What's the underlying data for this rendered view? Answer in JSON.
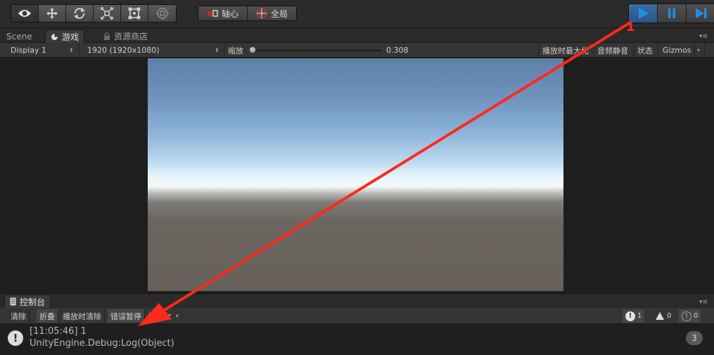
{
  "toolbar": {
    "tools": [
      {
        "name": "hand-tool",
        "icon": "eye-icon"
      },
      {
        "name": "move-tool",
        "icon": "move-icon"
      },
      {
        "name": "rotate-tool",
        "icon": "rotate-icon"
      },
      {
        "name": "scale-tool",
        "icon": "scale-icon"
      },
      {
        "name": "rect-tool",
        "icon": "rect-icon"
      },
      {
        "name": "transform-tool",
        "icon": "transform-icon"
      }
    ],
    "pivot_label": "轴心",
    "global_label": "全局",
    "play": {
      "active": true,
      "accent": "#3a6fa5",
      "icon_color": "#1e8fe8"
    }
  },
  "tabs": {
    "scene": "Scene",
    "game": "游戏",
    "asset_store": "资源商店"
  },
  "game_bar": {
    "display": "Display 1",
    "resolution": "1920 (1920x1080)",
    "scale_label": "缩放",
    "scale_value": "0.308",
    "maximize_on_play": "播放时最大化",
    "mute_audio": "音频静音",
    "stats": "状态",
    "gizmos": "Gizmos"
  },
  "console": {
    "tab_label": "控制台",
    "clear": "清除",
    "collapse": "折叠",
    "clear_on_play": "播放时清除",
    "error_pause": "错误暂停",
    "editor": "Editor",
    "log_count": "1",
    "warn_count": "0",
    "error_count": "0",
    "entries": [
      {
        "time_msg": "[11:05:46] 1",
        "detail": "UnityEngine.Debug:Log(Object)",
        "count": "3"
      }
    ]
  },
  "annotation": {
    "label": "1",
    "color": "#ff2a1a"
  }
}
